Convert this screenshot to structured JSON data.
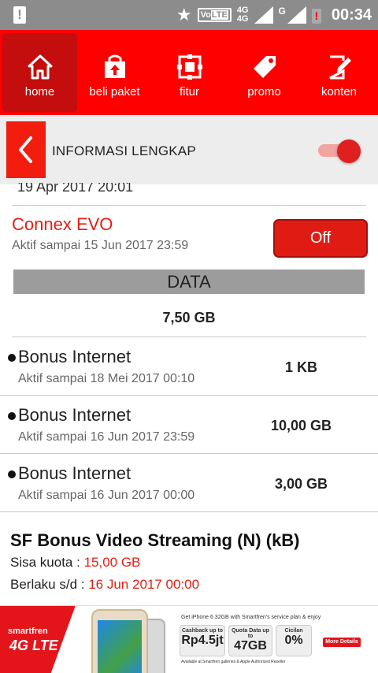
{
  "status_bar": {
    "volte": "Vo",
    "volte_tag": "LTE",
    "net_top": "4G",
    "net_bottom": "4G",
    "net2": "G",
    "time": "00:34"
  },
  "nav": {
    "items": [
      {
        "label": "home",
        "icon": "home-icon",
        "active": true
      },
      {
        "label": "beli paket",
        "icon": "shop-icon",
        "active": false
      },
      {
        "label": "fitur",
        "icon": "features-icon",
        "active": false
      },
      {
        "label": "promo",
        "icon": "tag-icon",
        "active": false
      },
      {
        "label": "konten",
        "icon": "edit-icon",
        "active": false
      }
    ]
  },
  "header": {
    "title": "INFORMASI LENGKAP",
    "toggle_on": true
  },
  "cut_off_date": "19 Apr 2017  20:01",
  "package": {
    "name": "Connex EVO",
    "active_until": "Aktif sampai 15 Jun 2017  23:59",
    "button": "Off"
  },
  "data": {
    "section_label": "DATA",
    "total": "7,50 GB",
    "bonuses": [
      {
        "name": "Bonus Internet",
        "active_until": "Aktif sampai 18 Mei 2017  00:10",
        "value": "1 KB"
      },
      {
        "name": "Bonus Internet",
        "active_until": "Aktif sampai 16 Jun 2017  23:59",
        "value": "10,00 GB"
      },
      {
        "name": "Bonus Internet",
        "active_until": "Aktif sampai 16 Jun 2017  00:00",
        "value": "3,00 GB"
      }
    ]
  },
  "streaming": {
    "title": "SF Bonus Video Streaming (N) (kB)",
    "quota_label": "Sisa kuota : ",
    "quota_value": "15,00 GB",
    "valid_label": "Berlaku s/d : ",
    "valid_value": "16 Jun 2017 00:00"
  },
  "ad": {
    "brand": "smartfren",
    "tech": "4G LTE",
    "headline": "Get iPhone 6 32GB with Smartfren's service plan & enjoy",
    "boxes": [
      {
        "label": "Cashback up to",
        "value": "Rp4.5jt",
        "sub": ""
      },
      {
        "label": "Quota Data up to",
        "value": "47GB",
        "sub": ""
      },
      {
        "label": "Cicilan",
        "value": "0%",
        "sub": ""
      }
    ],
    "footer": "Available at Smartfren galleries & Apple Authorized Reseller",
    "more": "More Details"
  }
}
